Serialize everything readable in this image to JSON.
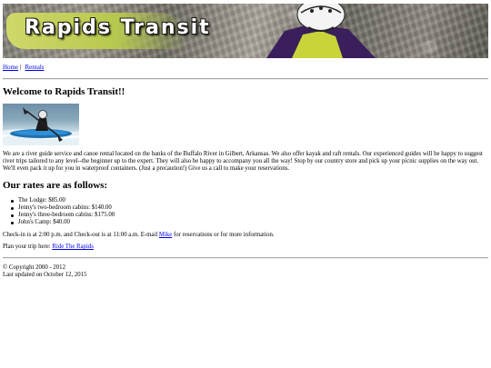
{
  "banner": {
    "logo_text": "Rapids Transit"
  },
  "nav": {
    "items": [
      {
        "label": "Home"
      },
      {
        "label": "Rentals"
      }
    ],
    "separator": "|"
  },
  "welcome": "Welcome to Rapids Transit!!",
  "intro": "We are a river guide service and canoe rental located on the banks of the Buffalo River in Gilbert, Arkansas. We also offer kayak and raft rentals. Our experienced guides will be happy to suggest river trips tailored to any level--the beginner up to the expert. They will also be happy to accompany you all the way! Stop by our country store and pick up your picnic supplies on the way out. We'll even pack it up for you in waterproof containers. (Just a precaution!) Give us a call to make your reservations.",
  "rates_heading": "Our rates are as follows:",
  "rates": [
    "The Lodge: $85.00",
    "Jenny's two-bedroom cabins: $140.00",
    "Jenny's three-bedroom cabins: $175.00",
    "John's Camp: $40.00"
  ],
  "checkin": {
    "text_before": "Check-in is at 2:00 p.m. and Check-out is at 11:00 a.m. E-mail ",
    "link": "Mike",
    "text_after": " for reservations or for more information."
  },
  "plan": {
    "text_before": "Plan your trip here: ",
    "link": "Ride The Rapids"
  },
  "footer": {
    "copyright": "© Copyright 2000 - 2012",
    "updated": "Last updated on October 12, 2015"
  }
}
